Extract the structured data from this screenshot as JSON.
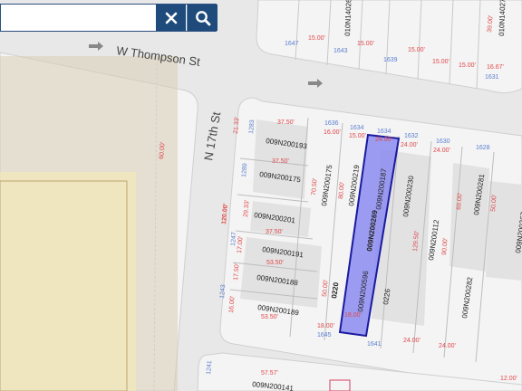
{
  "search": {
    "value": "",
    "placeholder": ""
  },
  "icons": {
    "clear": "close-icon",
    "search": "search-icon",
    "arrow": "arrow-right-icon"
  },
  "colors": {
    "highlight_fill": "#8b8bf0",
    "highlight_stroke": "#1a1aa0",
    "dimension_red": "#e0484b",
    "address_blue": "#5b7fd0",
    "search_button": "#1f4a7c"
  },
  "streets": {
    "w_thompson": "W Thompson St",
    "n_17th": "N 17th St"
  },
  "parcels": {
    "p193": "009N200193",
    "p175": "009N200175",
    "p201": "009N200201",
    "p191": "009N200191",
    "p188": "009N200188",
    "p189": "009N200189",
    "p175b": "009N200175",
    "p219": "009N200219",
    "p230": "009N200230",
    "p112": "009N200112",
    "p281": "009N200281",
    "p267": "009N200267",
    "p282": "009N200282",
    "p141": "009N200141",
    "p_top": "010N14026",
    "p_topright": "010N14027",
    "hl_a": "009N200269",
    "hl_b": "009N200596",
    "hl_c": "009N200187",
    "b0220": "0220",
    "b0226": "0226"
  },
  "addresses": {
    "a1636": "1636",
    "a1634": "1634",
    "a1632": "1632",
    "a1630": "1630",
    "a1628": "1628",
    "a1283": "1283",
    "a1289": "1289",
    "a1247": "1247",
    "a1243": "1243",
    "a1645": "1645",
    "a1641": "1641",
    "a1647": "1647",
    "a1643": "1643",
    "a1639": "1639",
    "a1631": "1631",
    "a1241": "1241"
  },
  "dims": {
    "d3750": "37.50'",
    "d1600": "16.00'",
    "d1500": "15.00'",
    "d2133": "21.33'",
    "d2933": "29.33'",
    "d12000": "120.00'",
    "d1700": "17.00'",
    "d1750": "17.50'",
    "d5000": "50.00'",
    "d5350": "53.50'",
    "d8000": "80.00'",
    "d7050": "70.50'",
    "d2400": "24.00'",
    "d1800": "18.00'",
    "d1667": "16.67'",
    "d3900": "39.00'",
    "d5750": "57.57'",
    "d6000": "60.00'",
    "d6900": "69.00'",
    "d12950": "129.50'",
    "d9000": "90.00'",
    "d1200": "12.00'"
  }
}
